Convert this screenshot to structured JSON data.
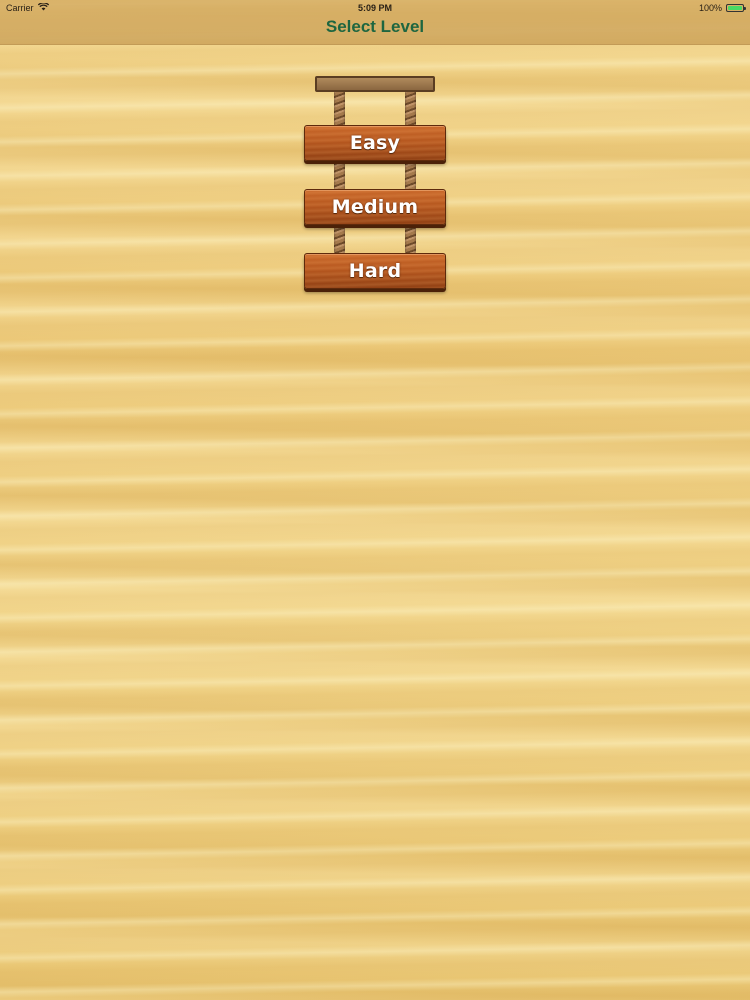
{
  "status_bar": {
    "carrier": "Carrier",
    "time": "5:09 PM",
    "battery_percent": "100%",
    "battery_level": 1.0,
    "icons": [
      "wifi-icon",
      "battery-icon"
    ]
  },
  "nav": {
    "title": "Select Level"
  },
  "levels": [
    {
      "label": "Easy"
    },
    {
      "label": "Medium"
    },
    {
      "label": "Hard"
    }
  ],
  "colors": {
    "title": "#1e6640",
    "plank": "#b5561e",
    "background": "#efce80",
    "battery": "#4cd964"
  }
}
